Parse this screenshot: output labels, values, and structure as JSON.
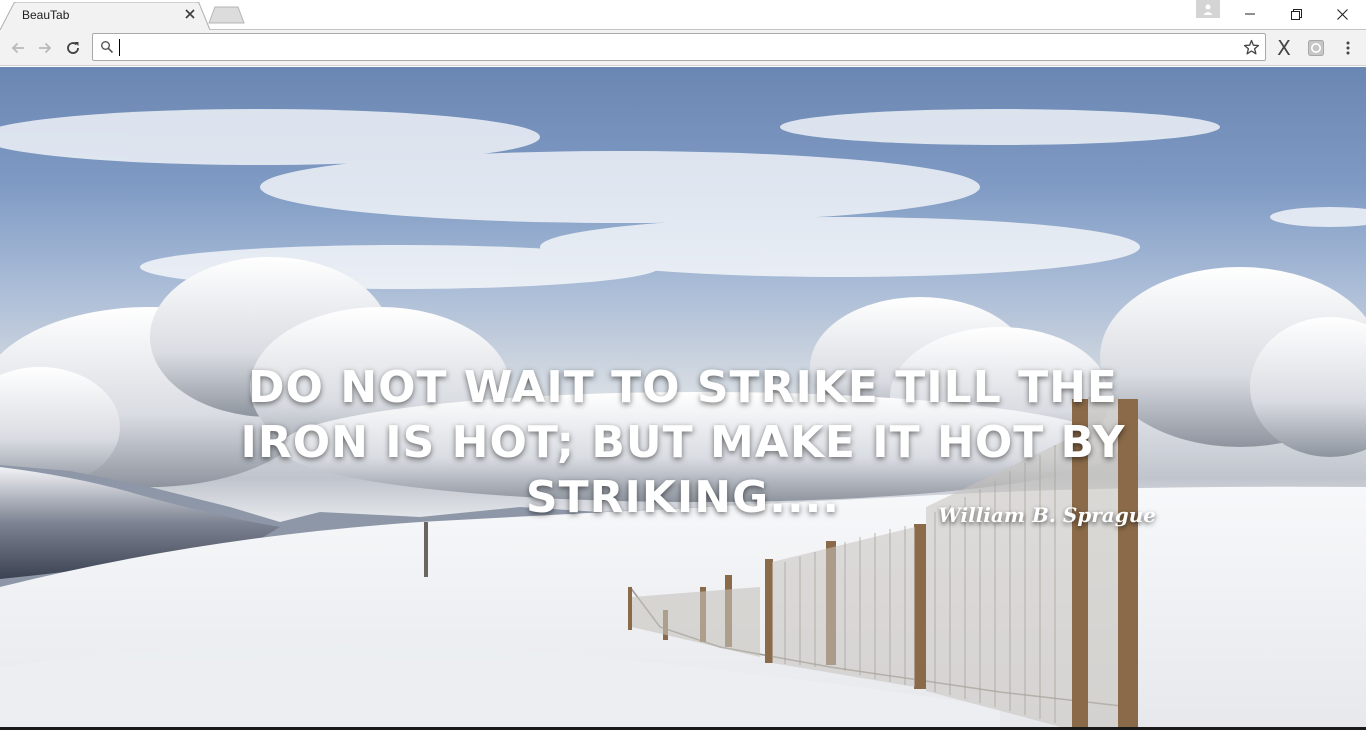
{
  "tab": {
    "title": "BeauTab"
  },
  "icons": {
    "tab_close": "close-icon",
    "new_tab": "new-tab-icon",
    "profile": "person-icon",
    "minimize": "minimize-icon",
    "restore": "restore-icon",
    "close": "close-icon",
    "back": "arrow-left-icon",
    "forward": "arrow-right-icon",
    "reload": "reload-icon",
    "search": "search-icon",
    "bookmark": "star-icon",
    "extension_x": "x-extension-icon",
    "extension_beautab": "beautab-extension-icon",
    "menu": "kebab-menu-icon"
  },
  "omnibox": {
    "value": "",
    "placeholder": ""
  },
  "extensions": {
    "x_label": "X"
  },
  "quote": {
    "text": "Do not wait to strike till the iron is hot; but make it hot by striking....",
    "author": "William B. Sprague"
  },
  "colors": {
    "sky": "#7f9bc4",
    "snow": "#f4f5f7",
    "text": "#ffffff"
  }
}
